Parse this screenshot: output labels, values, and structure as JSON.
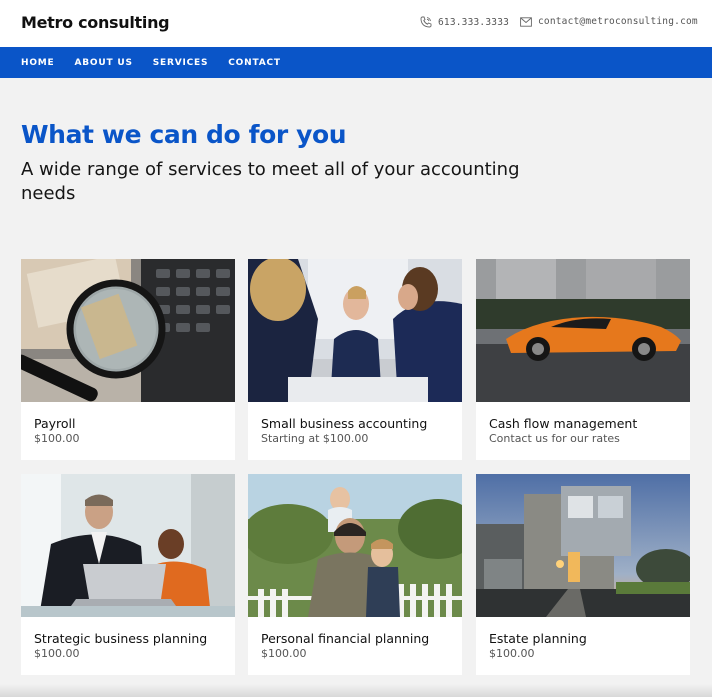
{
  "header": {
    "brand": "Metro consulting",
    "phone": "613.333.3333",
    "email": "contact@metroconsulting.com",
    "phone_icon": "phone-icon",
    "email_icon": "envelope-icon"
  },
  "nav": {
    "items": [
      {
        "label": "HOME"
      },
      {
        "label": "ABOUT US"
      },
      {
        "label": "SERVICES"
      },
      {
        "label": "CONTACT"
      }
    ],
    "color": "#0a55c8"
  },
  "main": {
    "heading": "What we can do for you",
    "subheading": "A wide range of services to meet all of your accounting needs"
  },
  "services": [
    {
      "title": "Payroll",
      "price": "$100.00",
      "image": "magnifier-money-calculator-photo"
    },
    {
      "title": "Small business accounting",
      "price": "Starting at $100.00",
      "image": "business-meeting-photo"
    },
    {
      "title": "Cash flow management",
      "price": "Contact us for our rates",
      "image": "orange-sports-car-photo"
    },
    {
      "title": "Strategic business planning",
      "price": "$100.00",
      "image": "two-men-laptop-photo"
    },
    {
      "title": "Personal financial planning",
      "price": "$100.00",
      "image": "family-outdoors-photo"
    },
    {
      "title": "Estate planning",
      "price": "$100.00",
      "image": "modern-house-dusk-photo"
    }
  ],
  "colors": {
    "accent": "#0a55c8",
    "background": "#f2f2f2",
    "card": "#ffffff"
  }
}
